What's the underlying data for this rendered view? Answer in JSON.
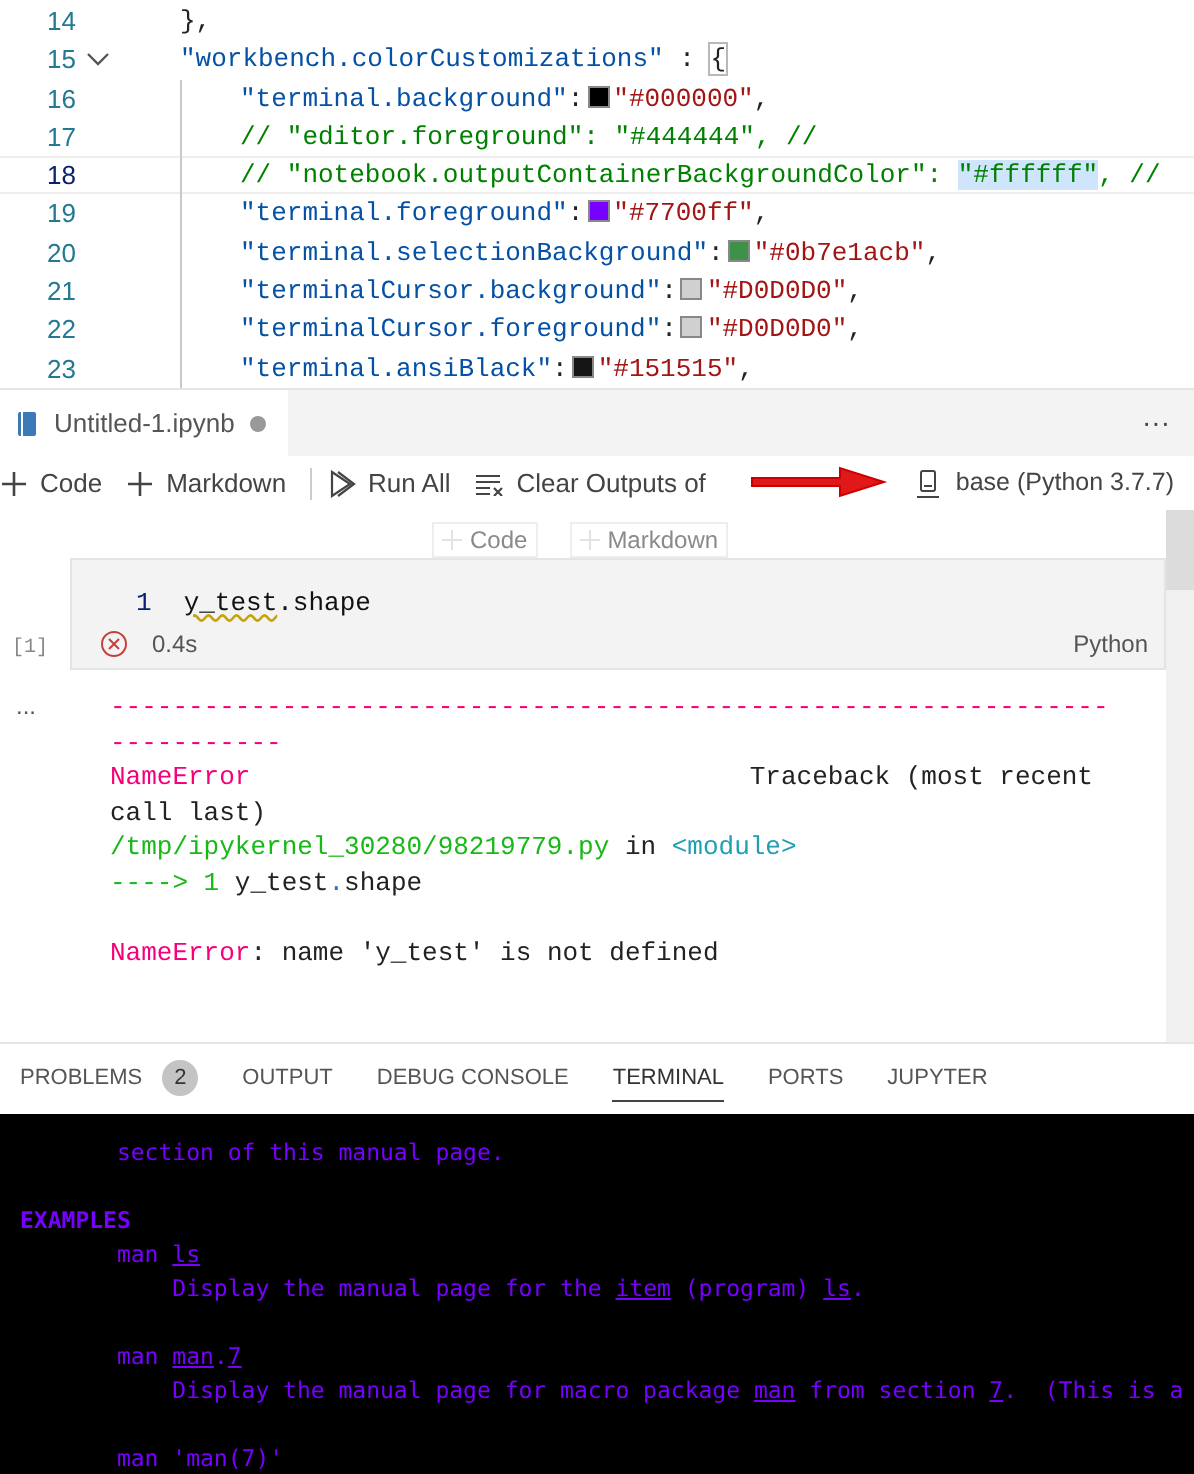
{
  "editor": {
    "lines": [
      {
        "number": "14",
        "current": false,
        "tokens": [
          {
            "kind": "punct",
            "text": "},"
          }
        ]
      },
      {
        "number": "15",
        "current": false,
        "expanded": true,
        "tokens": [
          {
            "kind": "key",
            "text": "\"workbench.colorCustomizations\""
          },
          {
            "kind": "punct",
            "text": " : "
          },
          {
            "kind": "bracket",
            "text": "{"
          }
        ],
        "children": [
          {
            "number": "16",
            "current": false,
            "tokens": [
              {
                "kind": "key",
                "text": "\"terminal.background\""
              },
              {
                "kind": "punct",
                "text": ":"
              },
              {
                "kind": "swatch",
                "color": "#000000"
              },
              {
                "kind": "string",
                "text": "\"#000000\""
              },
              {
                "kind": "punct",
                "text": ","
              }
            ]
          },
          {
            "number": "17",
            "current": false,
            "tokens": [
              {
                "kind": "comment",
                "text": "// \"editor.foreground\": \"#444444\", //"
              }
            ]
          },
          {
            "number": "18",
            "current": true,
            "tokens": [
              {
                "kind": "comment",
                "text": "// \"notebook.outputContainerBackgroundColor\": "
              },
              {
                "kind": "highlight",
                "text": "\"#ffffff\""
              },
              {
                "kind": "comment",
                "text": ", //"
              }
            ]
          },
          {
            "number": "19",
            "current": false,
            "tokens": [
              {
                "kind": "key",
                "text": "\"terminal.foreground\""
              },
              {
                "kind": "punct",
                "text": ":"
              },
              {
                "kind": "swatch",
                "color": "#7700ff"
              },
              {
                "kind": "string",
                "text": "\"#7700ff\""
              },
              {
                "kind": "punct",
                "text": ","
              }
            ]
          },
          {
            "number": "20",
            "current": false,
            "tokens": [
              {
                "kind": "key",
                "text": "\"terminal.selectionBackground\""
              },
              {
                "kind": "punct",
                "text": ":"
              },
              {
                "kind": "swatch",
                "color": "#3d9148"
              },
              {
                "kind": "string",
                "text": "\"#0b7e1acb\""
              },
              {
                "kind": "punct",
                "text": ","
              }
            ]
          },
          {
            "number": "21",
            "current": false,
            "tokens": [
              {
                "kind": "key",
                "text": "\"terminalCursor.background\""
              },
              {
                "kind": "punct",
                "text": ":"
              },
              {
                "kind": "swatch",
                "color": "#d0d0d0"
              },
              {
                "kind": "string",
                "text": "\"#D0D0D0\""
              },
              {
                "kind": "punct",
                "text": ","
              }
            ]
          },
          {
            "number": "22",
            "current": false,
            "tokens": [
              {
                "kind": "key",
                "text": "\"terminalCursor.foreground\""
              },
              {
                "kind": "punct",
                "text": ":"
              },
              {
                "kind": "swatch",
                "color": "#d0d0d0"
              },
              {
                "kind": "string",
                "text": "\"#D0D0D0\""
              },
              {
                "kind": "punct",
                "text": ","
              }
            ]
          },
          {
            "number": "23",
            "current": false,
            "tokens": [
              {
                "kind": "key",
                "text": "\"terminal.ansiBlack\""
              },
              {
                "kind": "punct",
                "text": ":"
              },
              {
                "kind": "swatch",
                "color": "#151515"
              },
              {
                "kind": "string",
                "text": "\"#151515\""
              },
              {
                "kind": "punct",
                "text": ","
              }
            ]
          }
        ]
      }
    ]
  },
  "notebook": {
    "tab": {
      "title": "Untitled-1.ipynb",
      "dirty": true
    },
    "more": "···",
    "toolbar": [
      {
        "kind": "add",
        "label": "Code"
      },
      {
        "kind": "add",
        "label": "Markdown"
      },
      {
        "kind": "run",
        "label": "Run All"
      },
      {
        "kind": "clear",
        "label": "Clear Outputs of"
      }
    ],
    "kernel": "base (Python 3.7.7)",
    "hover_buttons": [
      "Code",
      "Markdown"
    ],
    "cell": {
      "line_number": "1",
      "code": [
        {
          "kind": "warning",
          "text": "y_test"
        },
        {
          "kind": "plain",
          "text": ".shape"
        }
      ],
      "execution": "[1]",
      "time": "0.4s",
      "language": "Python"
    },
    "output_menu": "...",
    "output": {
      "traceback": [
        [
          {
            "kind": "error",
            "text": "---------------------------------------------------------------------------"
          }
        ],
        [
          {
            "kind": "error",
            "text": "NameError"
          },
          {
            "kind": "plain",
            "text": "                                Traceback (most recent call last)"
          }
        ],
        [
          {
            "kind": "path",
            "text": "/tmp/ipykernel_30280/98219779.py"
          },
          {
            "kind": "plain",
            "text": " in "
          },
          {
            "kind": "module",
            "text": "<module>"
          }
        ],
        [
          {
            "kind": "path",
            "text": "----> 1 "
          },
          {
            "kind": "plain",
            "text": "y_test"
          },
          {
            "kind": "dot",
            "text": "."
          },
          {
            "kind": "plain",
            "text": "shape"
          }
        ]
      ],
      "message": [
        {
          "kind": "error",
          "text": "NameError"
        },
        {
          "kind": "plain",
          "text": ": name 'y_test' is not defined"
        }
      ]
    }
  },
  "panel": {
    "tabs": [
      {
        "label": "PROBLEMS",
        "badge": "2",
        "selected": false
      },
      {
        "label": "OUTPUT",
        "selected": false
      },
      {
        "label": "DEBUG CONSOLE",
        "selected": false
      },
      {
        "label": "TERMINAL",
        "selected": true
      },
      {
        "label": "PORTS",
        "selected": false
      },
      {
        "label": "JUPYTER",
        "selected": false
      }
    ],
    "terminal": [
      {
        "kind": "text",
        "segments": [
          {
            "text": "       section of this manual page.",
            "underline": false
          }
        ]
      },
      {
        "kind": "blank"
      },
      {
        "kind": "heading",
        "segments": [
          {
            "text": "EXAMPLES",
            "underline": false
          }
        ]
      },
      {
        "kind": "text",
        "segments": [
          {
            "text": "       man ",
            "underline": false
          },
          {
            "text": "ls",
            "underline": true
          }
        ]
      },
      {
        "kind": "text",
        "segments": [
          {
            "text": "           Display the manual page for the ",
            "underline": false
          },
          {
            "text": "item",
            "underline": true
          },
          {
            "text": " (program) ",
            "underline": false
          },
          {
            "text": "ls",
            "underline": true
          },
          {
            "text": ".",
            "underline": false
          }
        ]
      },
      {
        "kind": "blank"
      },
      {
        "kind": "text",
        "segments": [
          {
            "text": "       man ",
            "underline": false
          },
          {
            "text": "man",
            "underline": true
          },
          {
            "text": ".",
            "underline": false
          },
          {
            "text": "7",
            "underline": true
          }
        ]
      },
      {
        "kind": "text",
        "segments": [
          {
            "text": "           Display the manual page for macro package ",
            "underline": false
          },
          {
            "text": "man",
            "underline": true
          },
          {
            "text": " from section ",
            "underline": false
          },
          {
            "text": "7",
            "underline": true
          },
          {
            "text": ".  (This is a",
            "underline": false
          }
        ]
      },
      {
        "kind": "blank"
      },
      {
        "kind": "text",
        "segments": [
          {
            "text": "       man 'man(7)'",
            "underline": false
          }
        ]
      }
    ]
  }
}
